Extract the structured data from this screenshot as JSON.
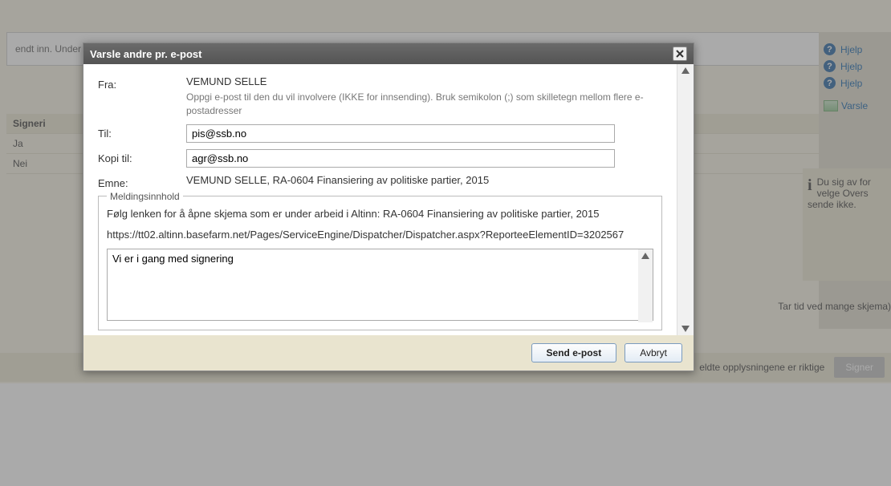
{
  "bg": {
    "banner_text": "endt inn. Under",
    "table": {
      "head": "Signeri",
      "row1": "Ja",
      "row2": "Nei"
    },
    "help_links": [
      "Hjelp",
      "Hjelp",
      "Hjelp"
    ],
    "varsle": "Varsle",
    "info_text": "Du sig av for velge Overs sende ikke.",
    "tartid": "Tar tid ved mange skjema)",
    "bottom_text": "eldte opplysningene er riktige",
    "signer_label": "Signer"
  },
  "modal": {
    "title": "Varsle andre pr. e-post",
    "from_label": "Fra:",
    "from_value": "VEMUND SELLE",
    "from_help": "Oppgi e-post til den du vil involvere (IKKE for innsending). Bruk semikolon (;) som skilletegn mellom flere e-postadresser",
    "to_label": "Til:",
    "to_value": "pis@ssb.no",
    "cc_label": "Kopi til:",
    "cc_value": "agr@ssb.no",
    "subject_label": "Emne:",
    "subject_value": "VEMUND SELLE, RA-0604 Finansiering av politiske partier, 2015",
    "fieldset_legend": "Meldingsinnhold",
    "msg_line1": "Følg lenken for å åpne skjema som er under arbeid i Altinn: RA-0604 Finansiering av politiske partier, 2015",
    "msg_line2": "https://tt02.altinn.basefarm.net/Pages/ServiceEngine/Dispatcher/Dispatcher.aspx?ReporteeElementID=3202567",
    "body_value": "Vi er i gang med signering ",
    "send_label": "Send e-post",
    "cancel_label": "Avbryt"
  }
}
